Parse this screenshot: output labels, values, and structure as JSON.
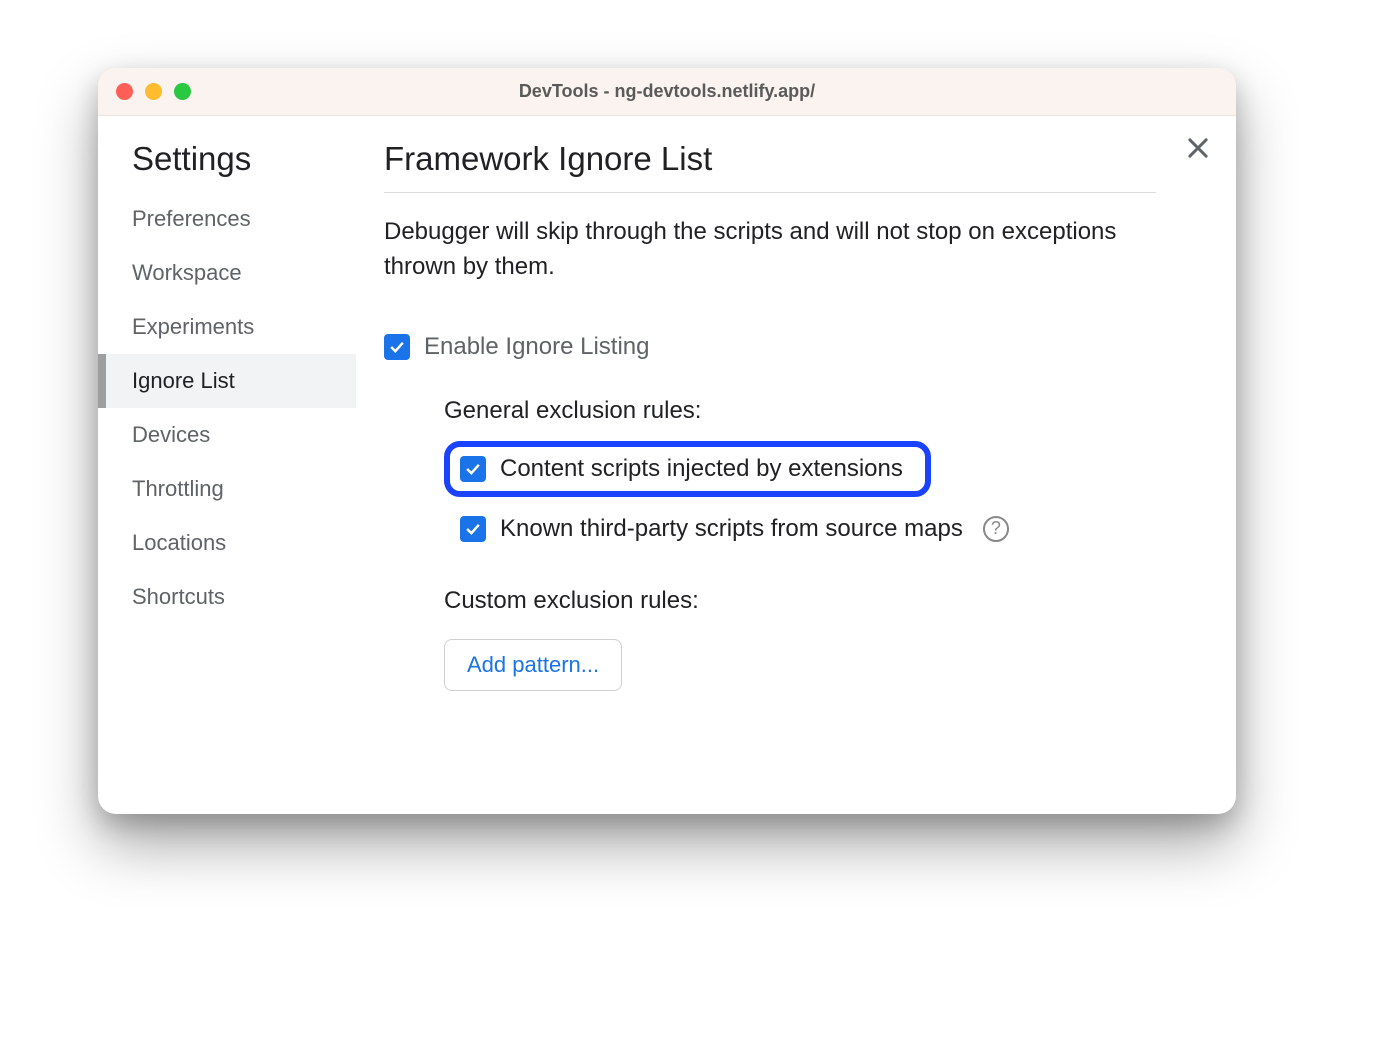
{
  "window": {
    "title": "DevTools - ng-devtools.netlify.app/"
  },
  "sidebar": {
    "title": "Settings",
    "items": [
      {
        "label": "Preferences",
        "active": false
      },
      {
        "label": "Workspace",
        "active": false
      },
      {
        "label": "Experiments",
        "active": false
      },
      {
        "label": "Ignore List",
        "active": true
      },
      {
        "label": "Devices",
        "active": false
      },
      {
        "label": "Throttling",
        "active": false
      },
      {
        "label": "Locations",
        "active": false
      },
      {
        "label": "Shortcuts",
        "active": false
      }
    ]
  },
  "main": {
    "title": "Framework Ignore List",
    "description": "Debugger will skip through the scripts and will not stop on exceptions thrown by them.",
    "enable_label": "Enable Ignore Listing",
    "enable_checked": true,
    "general_section_label": "General exclusion rules:",
    "rules": {
      "content_scripts": {
        "label": "Content scripts injected by extensions",
        "checked": true,
        "highlighted": true
      },
      "third_party": {
        "label": "Known third-party scripts from source maps",
        "checked": true
      }
    },
    "custom_section_label": "Custom exclusion rules:",
    "add_pattern_label": "Add pattern...",
    "help_icon_text": "?"
  },
  "colors": {
    "accent": "#1a73e8",
    "highlight_border": "#1a42ff"
  }
}
